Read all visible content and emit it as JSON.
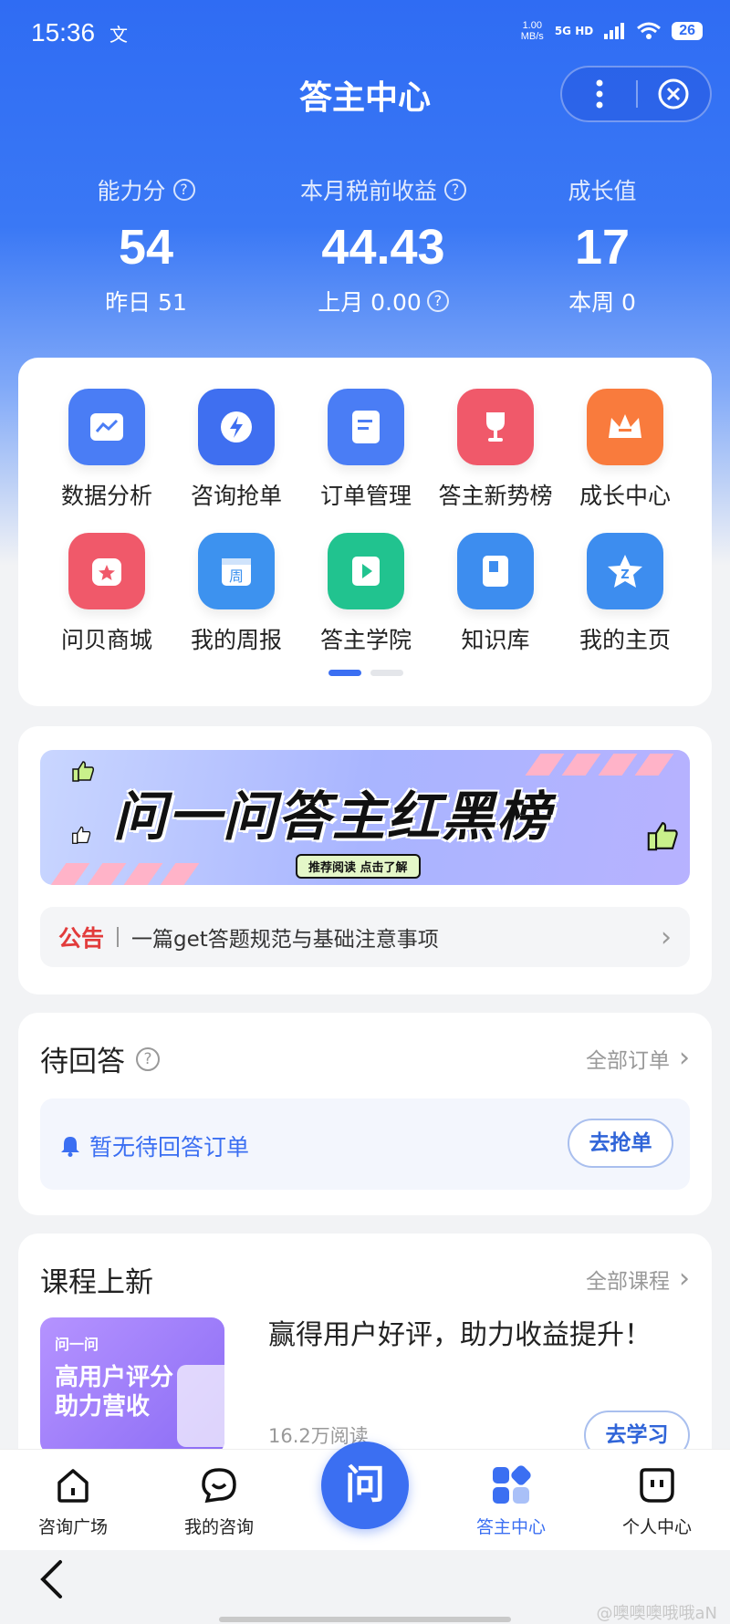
{
  "status_bar": {
    "time": "15:36",
    "lang_icon": "文",
    "net_speed_value": "1.00",
    "net_speed_unit": "MB/s",
    "network": "5G HD",
    "battery": "26"
  },
  "header": {
    "title": "答主中心"
  },
  "stats": [
    {
      "label": "能力分",
      "value": "54",
      "sub": "昨日 51"
    },
    {
      "label": "本月税前收益",
      "value": "44.43",
      "sub": "上月 0.00"
    },
    {
      "label": "成长值",
      "value": "17",
      "sub": "本周 0"
    }
  ],
  "grid": [
    {
      "label": "数据分析",
      "icon": "chart-icon",
      "color": "#4a7df5"
    },
    {
      "label": "咨询抢单",
      "icon": "lightning-icon",
      "color": "#3f6ff0"
    },
    {
      "label": "订单管理",
      "icon": "document-icon",
      "color": "#4a7df5"
    },
    {
      "label": "答主新势榜",
      "icon": "trophy-icon",
      "color": "#f0596a"
    },
    {
      "label": "成长中心",
      "icon": "crown-icon",
      "color": "#f97b3d"
    },
    {
      "label": "问贝商城",
      "icon": "shop-icon",
      "color": "#f0596a"
    },
    {
      "label": "我的周报",
      "icon": "calendar-icon",
      "color": "#3d92ef"
    },
    {
      "label": "答主学院",
      "icon": "play-icon",
      "color": "#21c38f"
    },
    {
      "label": "知识库",
      "icon": "book-icon",
      "color": "#3d8def"
    },
    {
      "label": "我的主页",
      "icon": "star-icon",
      "color": "#3d8def"
    }
  ],
  "banner": {
    "title": "问一问答主红黑榜",
    "pill": "推荐阅读 点击了解"
  },
  "notice": {
    "tag": "公告",
    "text": "一篇get答题规范与基础注意事项"
  },
  "pending": {
    "title": "待回答",
    "link": "全部订单",
    "empty_text": "暂无待回答订单",
    "button": "去抢单"
  },
  "courses": {
    "title": "课程上新",
    "link": "全部课程",
    "thumb_brand": "问一问",
    "thumb_line1": "高用户评分",
    "thumb_line2": "助力营收",
    "item_title": "赢得用户好评，助力收益提升！",
    "reads": "16.2万阅读",
    "button": "去学习"
  },
  "tabbar": [
    {
      "label": "咨询广场",
      "icon": "home-icon",
      "active": false
    },
    {
      "label": "我的咨询",
      "icon": "chat-icon",
      "active": false
    },
    {
      "label": "问",
      "icon": "ask-icon",
      "active": false
    },
    {
      "label": "答主中心",
      "icon": "grid-icon",
      "active": true
    },
    {
      "label": "个人中心",
      "icon": "profile-icon",
      "active": false
    }
  ],
  "watermark": "@噢噢噢哦哦aN",
  "colors": {
    "primary": "#3b6ff2",
    "notice_red": "#e23b3b"
  }
}
